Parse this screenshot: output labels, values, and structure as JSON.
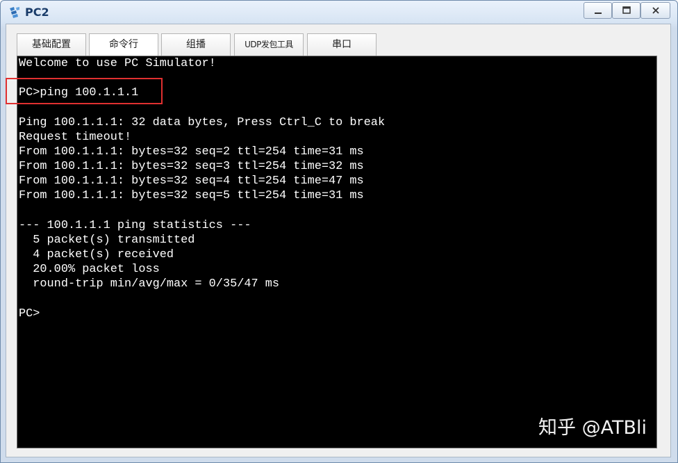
{
  "window": {
    "title": "PC2",
    "app_icon": "network-pc-icon",
    "controls": {
      "minimize_icon": "minimize-icon",
      "maximize_icon": "maximize-icon",
      "close_icon": "close-icon"
    }
  },
  "tabs": [
    {
      "label": "基础配置"
    },
    {
      "label": "命令行",
      "active": true
    },
    {
      "label": "组播"
    },
    {
      "label": "UDP发包工具"
    },
    {
      "label": "串口"
    }
  ],
  "terminal": {
    "lines": [
      "Welcome to use PC Simulator!",
      "",
      "PC>ping 100.1.1.1",
      "",
      "Ping 100.1.1.1: 32 data bytes, Press Ctrl_C to break",
      "Request timeout!",
      "From 100.1.1.1: bytes=32 seq=2 ttl=254 time=31 ms",
      "From 100.1.1.1: bytes=32 seq=3 ttl=254 time=32 ms",
      "From 100.1.1.1: bytes=32 seq=4 ttl=254 time=47 ms",
      "From 100.1.1.1: bytes=32 seq=5 ttl=254 time=31 ms",
      "",
      "--- 100.1.1.1 ping statistics ---",
      "  5 packet(s) transmitted",
      "  4 packet(s) received",
      "  20.00% packet loss",
      "  round-trip min/avg/max = 0/35/47 ms",
      "",
      "PC>"
    ],
    "highlight_color": "#e03030",
    "background": "#000000",
    "foreground": "#ffffff"
  },
  "watermark": {
    "text": "知乎 @ATBli"
  }
}
